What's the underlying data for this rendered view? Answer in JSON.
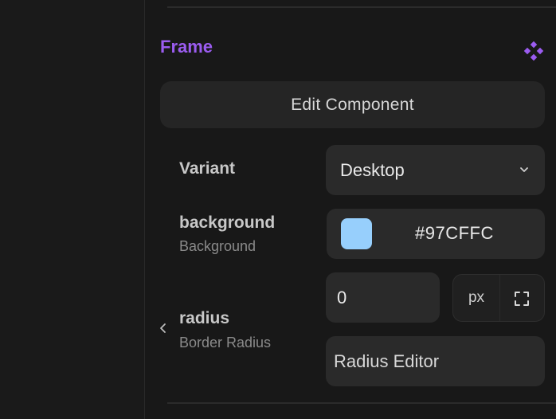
{
  "section": {
    "title": "Frame",
    "icon": "component-diamond-icon",
    "accent": "#9b5cf0"
  },
  "edit_button": {
    "label": "Edit Component"
  },
  "variant": {
    "label": "Variant",
    "value": "Desktop"
  },
  "background": {
    "label": "background",
    "sublabel": "Background",
    "value": "#97CFFC",
    "swatch_color": "#97CFFC"
  },
  "radius": {
    "label": "radius",
    "sublabel": "Border Radius",
    "value": "0",
    "unit": "px",
    "editor_label": "Radius Editor"
  }
}
